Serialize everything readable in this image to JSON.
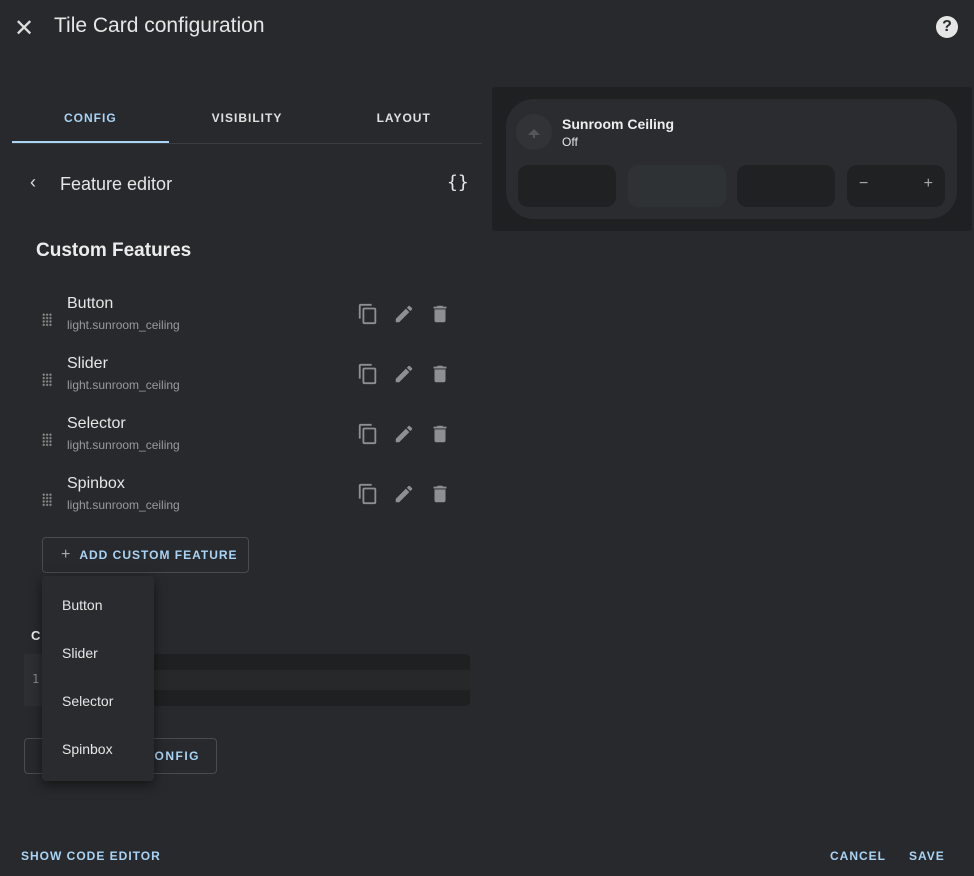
{
  "dialog": {
    "title": "Tile Card configuration",
    "close_icon": "close-icon",
    "help_icon": "help-circle-icon"
  },
  "tabs": [
    {
      "label": "CONFIG",
      "active": true
    },
    {
      "label": "VISIBILITY"
    },
    {
      "label": "LAYOUT"
    }
  ],
  "feature_editor": {
    "title": "Feature editor",
    "code_icon": "{}"
  },
  "custom_features": {
    "heading": "Custom Features",
    "items": [
      {
        "name": "Button",
        "entity": "light.sunroom_ceiling"
      },
      {
        "name": "Slider",
        "entity": "light.sunroom_ceiling"
      },
      {
        "name": "Selector",
        "entity": "light.sunroom_ceiling"
      },
      {
        "name": "Spinbox",
        "entity": "light.sunroom_ceiling"
      }
    ],
    "add_label": "ADD CUSTOM FEATURE"
  },
  "menu": {
    "items": [
      "Button",
      "Slider",
      "Selector",
      "Spinbox"
    ]
  },
  "partially_hidden": {
    "heading_visible": "C",
    "line_number": "1",
    "button_visible": "CONFIG"
  },
  "preview": {
    "name": "Sunroom Ceiling",
    "state": "Off",
    "minus": "−",
    "plus": "+"
  },
  "footer": {
    "code_editor": "SHOW CODE EDITOR",
    "cancel": "CANCEL",
    "save": "SAVE"
  },
  "colors": {
    "accent": "#a9d4f5",
    "background": "#28292c"
  }
}
